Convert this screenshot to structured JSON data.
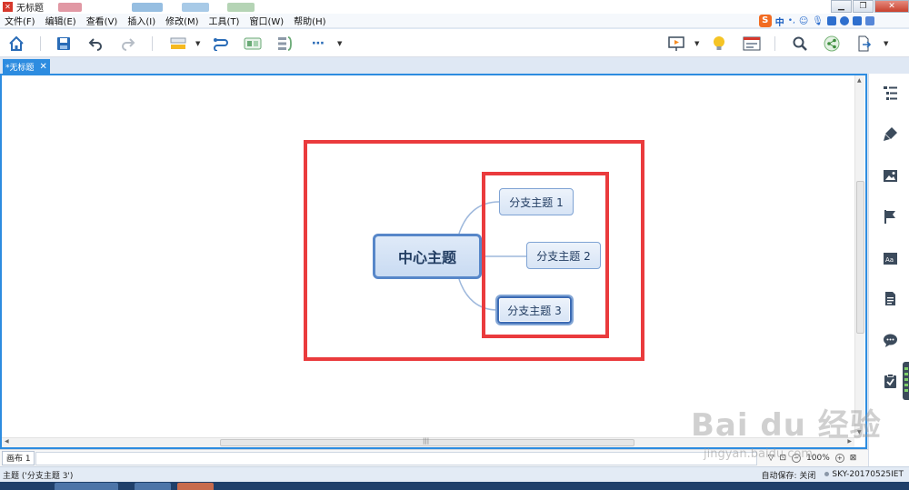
{
  "window": {
    "title": "无标题",
    "app_icon": "xmind-logo",
    "controls": [
      "minimize",
      "maximize",
      "close"
    ]
  },
  "menu": {
    "items": [
      "文件(F)",
      "编辑(E)",
      "查看(V)",
      "插入(I)",
      "修改(M)",
      "工具(T)",
      "窗口(W)",
      "帮助(H)"
    ]
  },
  "ime": {
    "logo": "S",
    "mode": "中",
    "icons": [
      "punctuation-icon",
      "emoji-icon",
      "mic-icon",
      "keyboard-icon",
      "user-icon",
      "shirt-icon",
      "grid-icon"
    ]
  },
  "toolbar": {
    "left_icons": [
      "home-icon",
      "save-icon",
      "undo-icon",
      "redo-icon",
      "topic-style-icon",
      "relationship-icon",
      "boundary-icon",
      "summary-icon",
      "more-icon"
    ],
    "right_icons": [
      "presentation-icon",
      "idea-icon",
      "outline-view-icon",
      "search-icon",
      "share-icon",
      "export-icon"
    ]
  },
  "tab": {
    "label": "*无标题",
    "close": "✕"
  },
  "mindmap": {
    "central_topic": "中心主题",
    "branches": [
      {
        "label": "分支主题 1"
      },
      {
        "label": "分支主题 2"
      },
      {
        "label": "分支主题 3",
        "selected": true
      }
    ],
    "colors": {
      "node_border": "#5787c9",
      "connector": "#9eb8dc",
      "highlight_box": "#ea3b3d",
      "accent": "#2d8ce0"
    }
  },
  "right_panel": {
    "icons": [
      "outline-icon",
      "format-brush-icon",
      "image-icon",
      "marker-flag-icon",
      "font-icon",
      "notes-icon",
      "comment-icon",
      "task-icon"
    ]
  },
  "sheet": {
    "tab_label": "画布 1",
    "zoom": "100%"
  },
  "status": {
    "selection": "主题 ('分支主题 3')",
    "autosave": "自动保存: 关闭",
    "user": "SKY-20170525IET"
  },
  "watermark": {
    "brand": "Bai du 经验",
    "url": "jingyan.baidu.com"
  }
}
